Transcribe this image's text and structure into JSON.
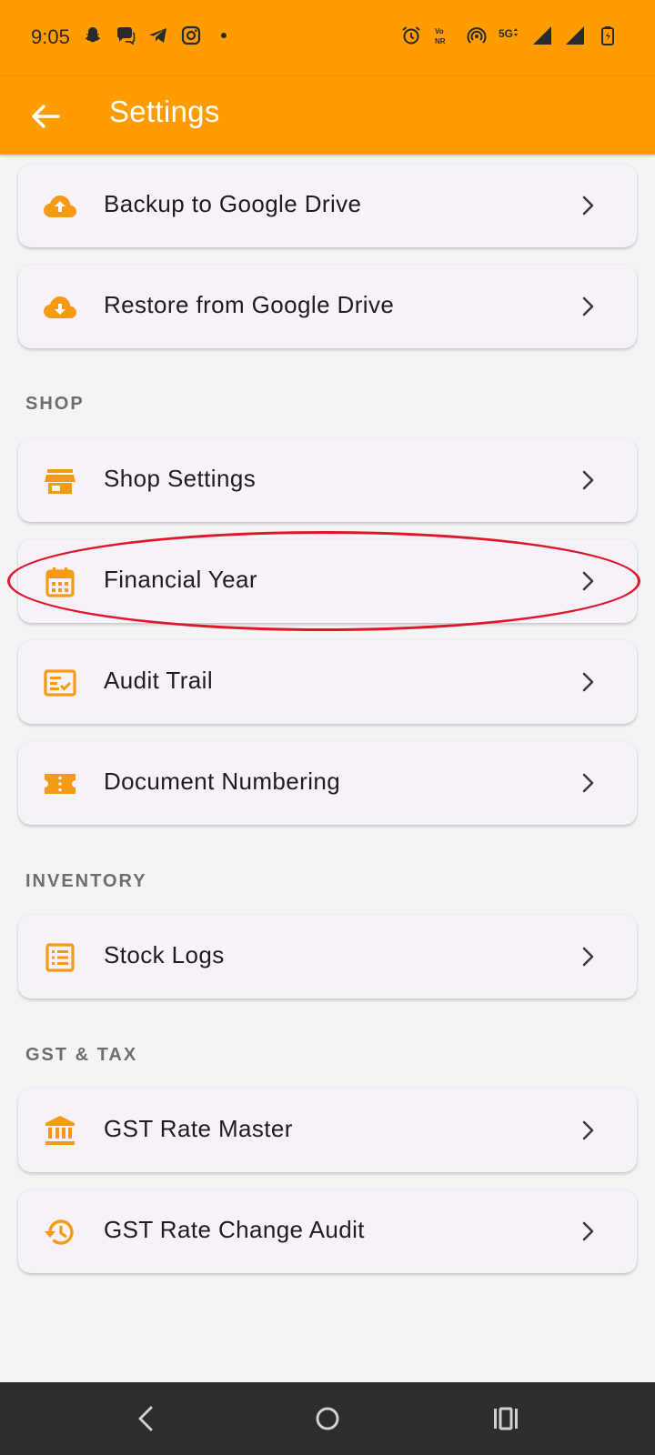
{
  "status_bar": {
    "time": "9:05",
    "left_icons": [
      "snapchat-icon",
      "chat-icon",
      "telegram-icon",
      "instagram-icon",
      "dot-icon"
    ],
    "right_icons": [
      "alarm-icon",
      "vonr-icon",
      "hotspot-icon",
      "5g-icon",
      "signal-icon",
      "signal-icon",
      "battery-icon"
    ]
  },
  "app_bar": {
    "title": "Settings",
    "back_icon": "arrow-left-icon"
  },
  "cards": {
    "backup": {
      "label": "Backup to Google Drive",
      "icon": "cloud-upload-icon"
    },
    "restore": {
      "label": "Restore from Google Drive",
      "icon": "cloud-download-icon"
    },
    "shop_settings": {
      "label": "Shop Settings",
      "icon": "store-icon"
    },
    "financial_year": {
      "label": "Financial Year",
      "icon": "calendar-icon"
    },
    "audit_trail": {
      "label": "Audit Trail",
      "icon": "checklist-icon"
    },
    "document_numbering": {
      "label": "Document Numbering",
      "icon": "ticket-icon"
    },
    "stock_logs": {
      "label": "Stock Logs",
      "icon": "list-icon"
    },
    "gst_rate_master": {
      "label": "GST Rate Master",
      "icon": "bank-icon"
    },
    "gst_rate_change_audit": {
      "label": "GST Rate Change Audit",
      "icon": "history-icon"
    }
  },
  "sections": {
    "shop": "SHOP",
    "inventory": "INVENTORY",
    "gst_tax": "GST & TAX"
  },
  "colors": {
    "accent": "#ff9c00",
    "icon": "#f59a14",
    "card_bg": "#f7f2fa",
    "highlight": "#e0162b",
    "nav_bar": "#2d2d2d"
  },
  "nav_bar": {
    "buttons": [
      "back-nav-icon",
      "home-nav-icon",
      "recents-nav-icon"
    ]
  }
}
